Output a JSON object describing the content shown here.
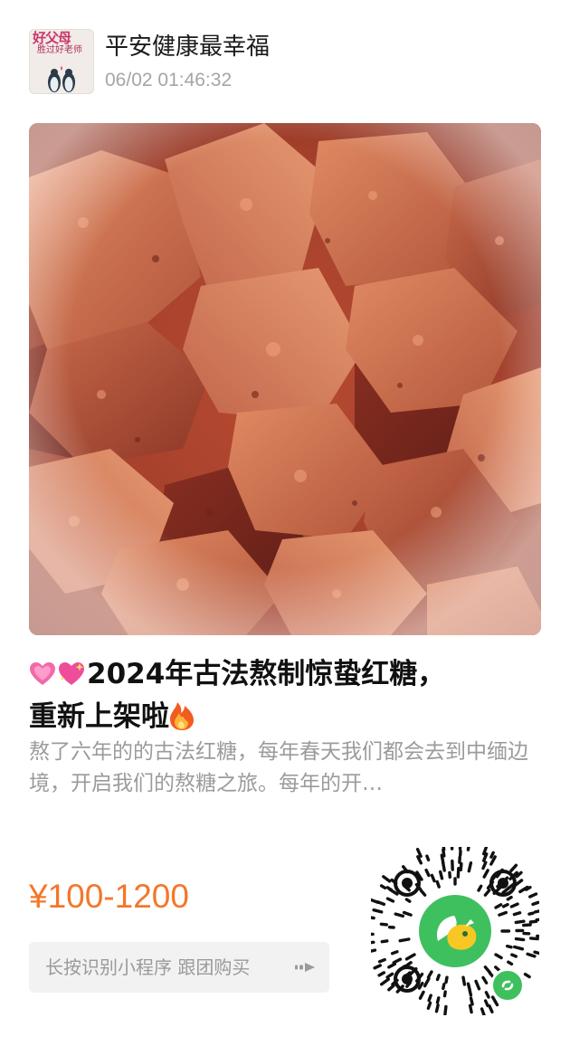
{
  "header": {
    "shop_name": "平安健康最幸福",
    "post_time": "06/02 01:46:32",
    "avatar_title": "好父母",
    "avatar_subtitle": "胜过好老师"
  },
  "product": {
    "title_line1": "2024年古法熬制惊蛰红糖，",
    "title_line2": "重新上架啦",
    "description": "熬了六年的的古法红糖，每年春天我们都会去到中缅边境，开启我们的熬糖之旅。每年的开…",
    "price": "¥100-1200"
  },
  "cta": {
    "label": "长按识别小程序 跟团购买"
  },
  "icons": {
    "heart1": "growing-heart-icon",
    "heart2": "sparkling-heart-icon",
    "fire": "fire-icon",
    "arrow": "forward-arrow-icon",
    "mini_program": "mini-program-link-icon"
  },
  "colors": {
    "price": "#f4772a",
    "qr_logo_green": "#3fc05f",
    "qr_logo_yellow": "#f7c824"
  }
}
